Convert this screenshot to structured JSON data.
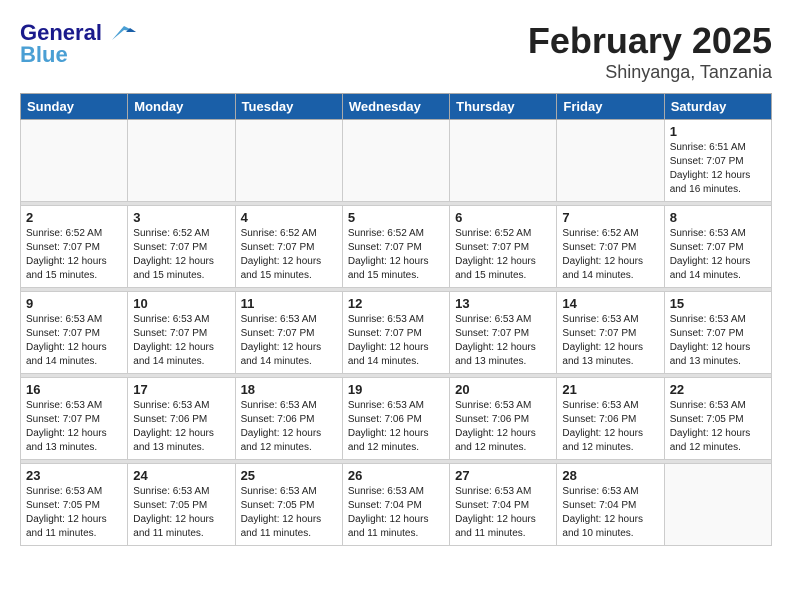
{
  "header": {
    "logo_line1": "General",
    "logo_line2": "Blue",
    "month": "February 2025",
    "location": "Shinyanga, Tanzania"
  },
  "weekdays": [
    "Sunday",
    "Monday",
    "Tuesday",
    "Wednesday",
    "Thursday",
    "Friday",
    "Saturday"
  ],
  "weeks": [
    [
      {
        "day": "",
        "info": ""
      },
      {
        "day": "",
        "info": ""
      },
      {
        "day": "",
        "info": ""
      },
      {
        "day": "",
        "info": ""
      },
      {
        "day": "",
        "info": ""
      },
      {
        "day": "",
        "info": ""
      },
      {
        "day": "1",
        "info": "Sunrise: 6:51 AM\nSunset: 7:07 PM\nDaylight: 12 hours\nand 16 minutes."
      }
    ],
    [
      {
        "day": "2",
        "info": "Sunrise: 6:52 AM\nSunset: 7:07 PM\nDaylight: 12 hours\nand 15 minutes."
      },
      {
        "day": "3",
        "info": "Sunrise: 6:52 AM\nSunset: 7:07 PM\nDaylight: 12 hours\nand 15 minutes."
      },
      {
        "day": "4",
        "info": "Sunrise: 6:52 AM\nSunset: 7:07 PM\nDaylight: 12 hours\nand 15 minutes."
      },
      {
        "day": "5",
        "info": "Sunrise: 6:52 AM\nSunset: 7:07 PM\nDaylight: 12 hours\nand 15 minutes."
      },
      {
        "day": "6",
        "info": "Sunrise: 6:52 AM\nSunset: 7:07 PM\nDaylight: 12 hours\nand 15 minutes."
      },
      {
        "day": "7",
        "info": "Sunrise: 6:52 AM\nSunset: 7:07 PM\nDaylight: 12 hours\nand 14 minutes."
      },
      {
        "day": "8",
        "info": "Sunrise: 6:53 AM\nSunset: 7:07 PM\nDaylight: 12 hours\nand 14 minutes."
      }
    ],
    [
      {
        "day": "9",
        "info": "Sunrise: 6:53 AM\nSunset: 7:07 PM\nDaylight: 12 hours\nand 14 minutes."
      },
      {
        "day": "10",
        "info": "Sunrise: 6:53 AM\nSunset: 7:07 PM\nDaylight: 12 hours\nand 14 minutes."
      },
      {
        "day": "11",
        "info": "Sunrise: 6:53 AM\nSunset: 7:07 PM\nDaylight: 12 hours\nand 14 minutes."
      },
      {
        "day": "12",
        "info": "Sunrise: 6:53 AM\nSunset: 7:07 PM\nDaylight: 12 hours\nand 14 minutes."
      },
      {
        "day": "13",
        "info": "Sunrise: 6:53 AM\nSunset: 7:07 PM\nDaylight: 12 hours\nand 13 minutes."
      },
      {
        "day": "14",
        "info": "Sunrise: 6:53 AM\nSunset: 7:07 PM\nDaylight: 12 hours\nand 13 minutes."
      },
      {
        "day": "15",
        "info": "Sunrise: 6:53 AM\nSunset: 7:07 PM\nDaylight: 12 hours\nand 13 minutes."
      }
    ],
    [
      {
        "day": "16",
        "info": "Sunrise: 6:53 AM\nSunset: 7:07 PM\nDaylight: 12 hours\nand 13 minutes."
      },
      {
        "day": "17",
        "info": "Sunrise: 6:53 AM\nSunset: 7:06 PM\nDaylight: 12 hours\nand 13 minutes."
      },
      {
        "day": "18",
        "info": "Sunrise: 6:53 AM\nSunset: 7:06 PM\nDaylight: 12 hours\nand 12 minutes."
      },
      {
        "day": "19",
        "info": "Sunrise: 6:53 AM\nSunset: 7:06 PM\nDaylight: 12 hours\nand 12 minutes."
      },
      {
        "day": "20",
        "info": "Sunrise: 6:53 AM\nSunset: 7:06 PM\nDaylight: 12 hours\nand 12 minutes."
      },
      {
        "day": "21",
        "info": "Sunrise: 6:53 AM\nSunset: 7:06 PM\nDaylight: 12 hours\nand 12 minutes."
      },
      {
        "day": "22",
        "info": "Sunrise: 6:53 AM\nSunset: 7:05 PM\nDaylight: 12 hours\nand 12 minutes."
      }
    ],
    [
      {
        "day": "23",
        "info": "Sunrise: 6:53 AM\nSunset: 7:05 PM\nDaylight: 12 hours\nand 11 minutes."
      },
      {
        "day": "24",
        "info": "Sunrise: 6:53 AM\nSunset: 7:05 PM\nDaylight: 12 hours\nand 11 minutes."
      },
      {
        "day": "25",
        "info": "Sunrise: 6:53 AM\nSunset: 7:05 PM\nDaylight: 12 hours\nand 11 minutes."
      },
      {
        "day": "26",
        "info": "Sunrise: 6:53 AM\nSunset: 7:04 PM\nDaylight: 12 hours\nand 11 minutes."
      },
      {
        "day": "27",
        "info": "Sunrise: 6:53 AM\nSunset: 7:04 PM\nDaylight: 12 hours\nand 11 minutes."
      },
      {
        "day": "28",
        "info": "Sunrise: 6:53 AM\nSunset: 7:04 PM\nDaylight: 12 hours\nand 10 minutes."
      },
      {
        "day": "",
        "info": ""
      }
    ]
  ]
}
